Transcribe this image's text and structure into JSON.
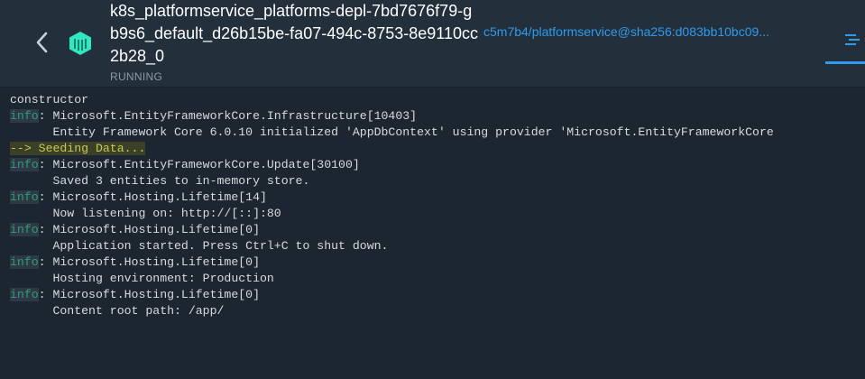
{
  "header": {
    "title": "k8s_platformservice_platforms-depl-7bd7676f79-gb9s6_default_d26b15be-fa07-494c-8753-8e9110cc2b28_0",
    "status": "RUNNING",
    "image": "c5m7b4/platformservice@sha256:d083bb10bc09..."
  },
  "icons": {
    "back": "chevron-left-icon",
    "container": "container-icon",
    "logs_tab": "logs-icon"
  },
  "colors": {
    "accent": "#2f9bef",
    "container_icon": "#2ee8c0",
    "info_level": "#27a079",
    "highlight": "#c9c94a"
  },
  "logs": {
    "lines": [
      {
        "level": "",
        "text": "constructor"
      },
      {
        "level": "info",
        "text": ": Microsoft.EntityFrameworkCore.Infrastructure[10403]"
      },
      {
        "level": "",
        "text": "      Entity Framework Core 6.0.10 initialized 'AppDbContext' using provider 'Microsoft.EntityFrameworkCore"
      },
      {
        "level": "highlight",
        "text": "--> Seeding Data..."
      },
      {
        "level": "info",
        "text": ": Microsoft.EntityFrameworkCore.Update[30100]"
      },
      {
        "level": "",
        "text": "      Saved 3 entities to in-memory store."
      },
      {
        "level": "info",
        "text": ": Microsoft.Hosting.Lifetime[14]"
      },
      {
        "level": "",
        "text": "      Now listening on: http://[::]:80"
      },
      {
        "level": "info",
        "text": ": Microsoft.Hosting.Lifetime[0]"
      },
      {
        "level": "",
        "text": "      Application started. Press Ctrl+C to shut down."
      },
      {
        "level": "info",
        "text": ": Microsoft.Hosting.Lifetime[0]"
      },
      {
        "level": "",
        "text": "      Hosting environment: Production"
      },
      {
        "level": "info",
        "text": ": Microsoft.Hosting.Lifetime[0]"
      },
      {
        "level": "",
        "text": "      Content root path: /app/"
      }
    ],
    "level_label": "info"
  }
}
